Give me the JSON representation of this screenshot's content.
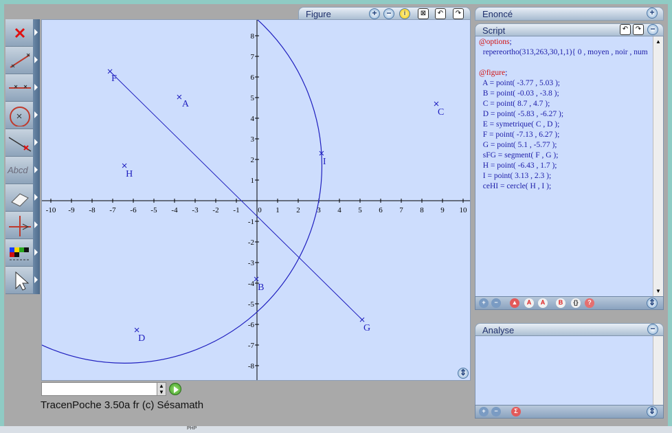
{
  "figure_panel": {
    "title": "Figure"
  },
  "enonce_panel": {
    "title": "Enoncé"
  },
  "script_panel": {
    "title": "Script",
    "lines": [
      "@options;",
      "  repereortho(313,263,30,1,1){ 0 , moyen , noir , num",
      "",
      "@figure;",
      "  A = point( -3.77 , 5.03 );",
      "  B = point( -0.03 , -3.8 );",
      "  C = point( 8.7 , 4.7 );",
      "  D = point( -5.83 , -6.27 );",
      "  E = symetrique( C , D );",
      "  F = point( -7.13 , 6.27 );",
      "  G = point( 5.1 , -5.77 );",
      "  sFG = segment( F , G );",
      "  H = point( -6.43 , 1.7 );",
      "  I = point( 3.13 , 2.3 );",
      "  ceHI = cercle( H , I );"
    ]
  },
  "analyse_panel": {
    "title": "Analyse"
  },
  "credit": "TracenPoche 3.50a fr (c) Sésamath",
  "taskbar_text": "PHP",
  "toolbar": {
    "items": [
      "delete-tool",
      "segment-tool",
      "line-tool",
      "circle-tool",
      "point-on-line-tool",
      "text-tool",
      "eraser-tool",
      "axis-tool",
      "color-tool",
      "pointer-tool"
    ],
    "text_tool_label": "Abcd"
  },
  "graph": {
    "x_ticks": [
      "-10",
      "-9",
      "-8",
      "-7",
      "-6",
      "-5",
      "-4",
      "-3",
      "-2",
      "-1",
      "0",
      "1",
      "2",
      "3",
      "4",
      "5",
      "6",
      "7",
      "8",
      "9",
      "10"
    ],
    "y_ticks": [
      "8",
      "7",
      "6",
      "5",
      "4",
      "3",
      "2",
      "1",
      "-1",
      "-2",
      "-3",
      "-4",
      "-5",
      "-6",
      "-7",
      "-8"
    ],
    "points": [
      {
        "name": "A",
        "x": -3.77,
        "y": 5.03
      },
      {
        "name": "B",
        "x": -0.03,
        "y": -3.8
      },
      {
        "name": "C",
        "x": 8.7,
        "y": 4.7
      },
      {
        "name": "D",
        "x": -5.83,
        "y": -6.27
      },
      {
        "name": "F",
        "x": -7.13,
        "y": 6.27
      },
      {
        "name": "G",
        "x": 5.1,
        "y": -5.77
      },
      {
        "name": "H",
        "x": -6.43,
        "y": 1.7
      },
      {
        "name": "I",
        "x": 3.13,
        "y": 2.3
      }
    ],
    "segment": {
      "from": "F",
      "to": "G"
    },
    "circle": {
      "center": "H",
      "through": "I"
    },
    "colors": {
      "axis": "#000000",
      "figure": "#1f1fbf",
      "background": "#cdddfd"
    }
  }
}
